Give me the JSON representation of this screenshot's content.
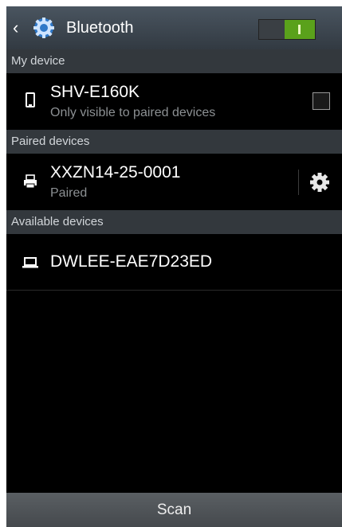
{
  "header": {
    "title": "Bluetooth",
    "back_icon": "chevron-left-icon",
    "app_icon": "settings-gear-icon",
    "toggle_state": "on"
  },
  "sections": {
    "my_device": "My device",
    "paired": "Paired devices",
    "available": "Available devices"
  },
  "my_device": {
    "name": "SHV-E160K",
    "subtitle": "Only visible to paired devices",
    "icon": "phone-icon",
    "checkbox_checked": false
  },
  "paired_device": {
    "name": "XXZN14-25-0001",
    "subtitle": "Paired",
    "icon": "printer-icon",
    "settings_icon": "gear-icon"
  },
  "available_device": {
    "name": "DWLEE-EAE7D23ED",
    "icon": "laptop-icon"
  },
  "footer": {
    "scan_label": "Scan"
  },
  "colors": {
    "toggle_on": "#5aa11b",
    "section_bg": "#33383d",
    "screen_bg": "#000000"
  }
}
